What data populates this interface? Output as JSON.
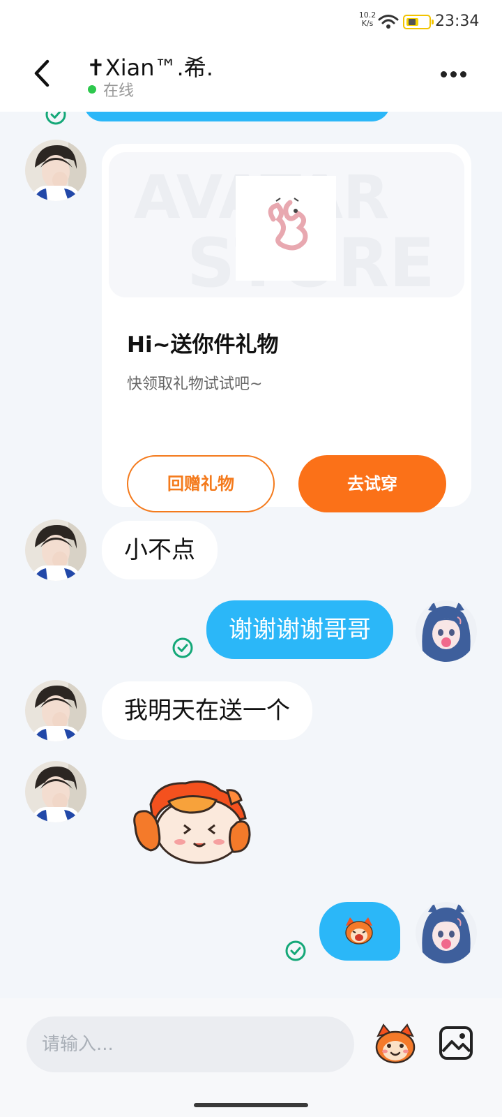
{
  "status_bar": {
    "net_speed_value": "10.2",
    "net_speed_unit": "K/s",
    "time": "23:34"
  },
  "header": {
    "contact_name": "✝Xian™.希.",
    "status": "在线"
  },
  "gift_card": {
    "title": "Hi~送你件礼物",
    "subtitle": "快领取礼物试试吧~",
    "return_gift_label": "回赠礼物",
    "try_on_label": "去试穿",
    "banner_text_top": "AVATAR",
    "banner_text_bottom": "STORE"
  },
  "messages": [
    {
      "direction": "in",
      "text": "小不点"
    },
    {
      "direction": "out",
      "text": "谢谢谢谢哥哥"
    },
    {
      "direction": "in",
      "text": "我明天在送一个"
    },
    {
      "direction": "in",
      "sticker": "orange-mascot-sticker"
    },
    {
      "direction": "out",
      "sticker": "small-mascot-emoji"
    }
  ],
  "input": {
    "placeholder": "请输入..."
  },
  "colors": {
    "accent_blue": "#2bb7f8",
    "accent_orange": "#fb7118",
    "online_green": "#2dc84d",
    "read_check": "#14a878"
  }
}
